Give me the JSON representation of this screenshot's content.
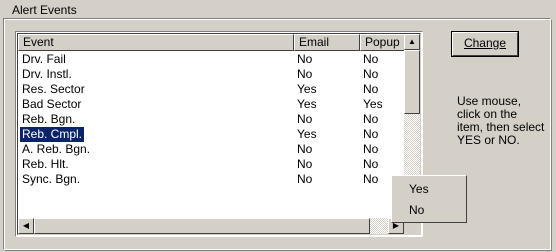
{
  "group": {
    "title": "Alert Events"
  },
  "list": {
    "columns": [
      "Event",
      "Email",
      "Popup"
    ],
    "rows": [
      {
        "event": "Drv. Fail",
        "email": "No",
        "popup": "No"
      },
      {
        "event": "Drv. Instl.",
        "email": "No",
        "popup": "No"
      },
      {
        "event": "Res. Sector",
        "email": "Yes",
        "popup": "No"
      },
      {
        "event": "Bad Sector",
        "email": "Yes",
        "popup": "Yes"
      },
      {
        "event": "Reb. Bgn.",
        "email": "No",
        "popup": "No"
      },
      {
        "event": "Reb. Cmpl.",
        "email": "Yes",
        "popup": "No",
        "selected": true
      },
      {
        "event": "A. Reb. Bgn.",
        "email": "No",
        "popup": "No"
      },
      {
        "event": "Reb. Hlt.",
        "email": "No",
        "popup": "No"
      },
      {
        "event": "Sync. Bgn.",
        "email": "No",
        "popup": "No"
      }
    ]
  },
  "buttons": {
    "change": "Change"
  },
  "help_text": "Use mouse,\nclick on the\nitem, then select\nYES or NO.",
  "popup_menu": {
    "items": [
      "Yes",
      "No"
    ]
  },
  "colors": {
    "face": "#d4d0c8",
    "selection": "#0a246a"
  }
}
